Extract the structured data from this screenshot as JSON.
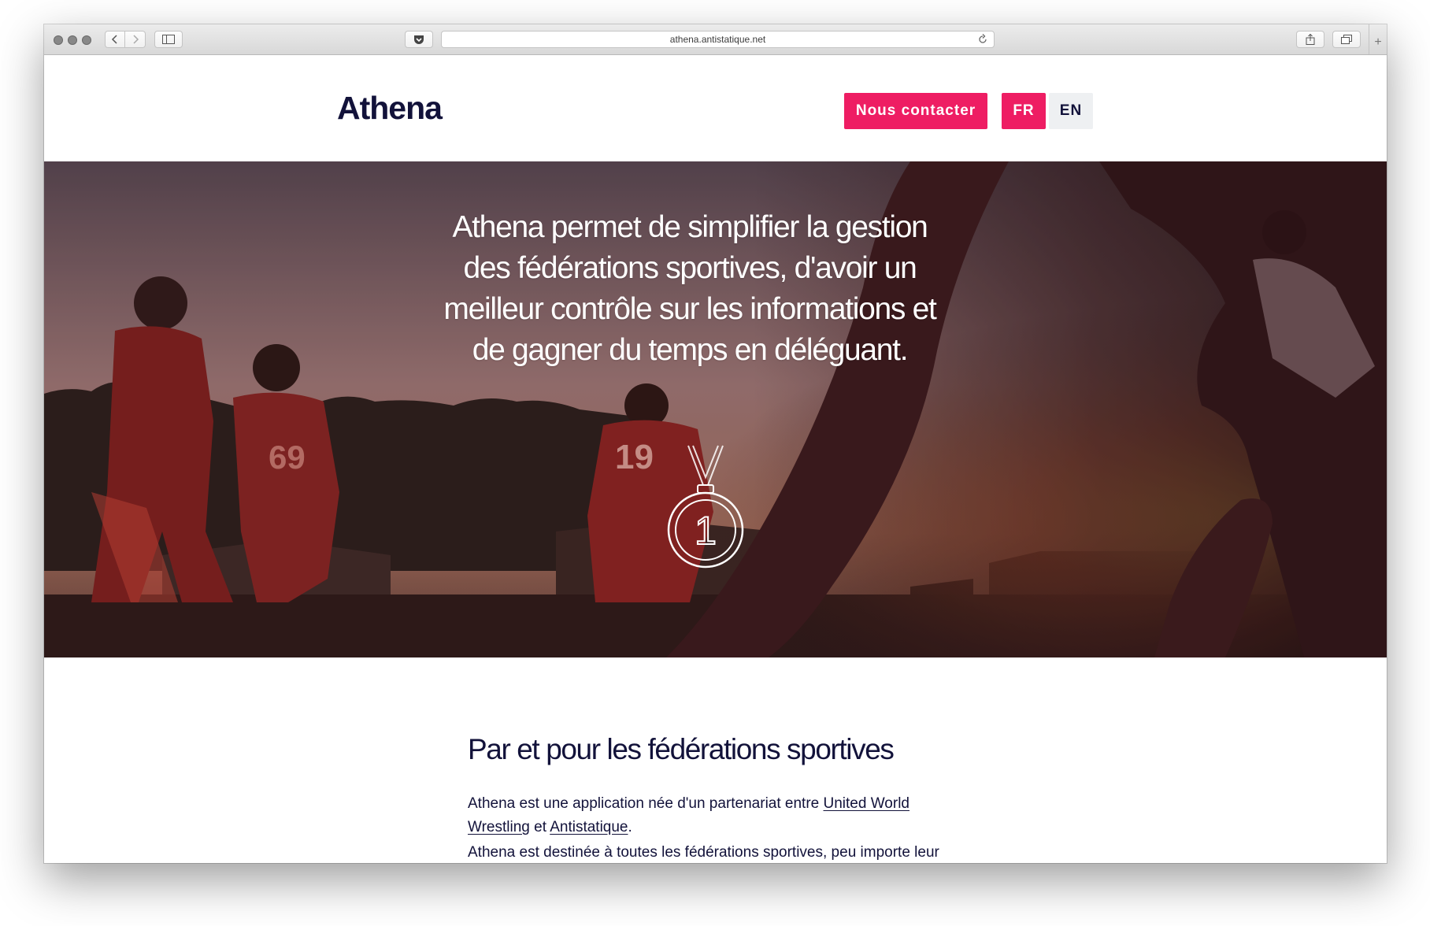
{
  "browser": {
    "url": "athena.antistatique.net",
    "traffic_light_color": "#888888"
  },
  "site": {
    "logo": "Athena",
    "contact_label": "Nous contacter",
    "lang_fr": "FR",
    "lang_en": "EN",
    "accent_color": "#ee1d63",
    "text_color": "#12123a"
  },
  "hero": {
    "tagline": "Athena permet de simplifier la gestion des fédérations sportives, d'avoir un meilleur contrôle sur les informations et de gagner du temps en déléguant.",
    "medal_number": "1",
    "jersey_numbers": [
      "19",
      "69"
    ]
  },
  "content": {
    "heading": "Par et pour les fédérations sportives",
    "p1_prefix": "Athena est une application née d'un partenariat entre ",
    "link_uww": "United World Wrestling",
    "p1_mid": " et ",
    "link_antistatique": "Antistatique",
    "p1_suffix": ".",
    "p2": "Athena est destinée à toutes les fédérations sportives, peu importe leur"
  }
}
